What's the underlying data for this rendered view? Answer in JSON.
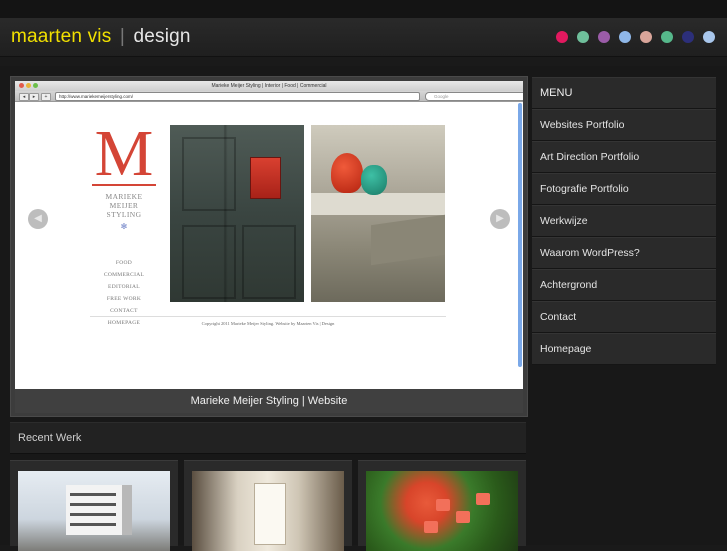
{
  "header": {
    "logo_name": "maarten vis",
    "logo_sep": "|",
    "logo_design": "design",
    "color_dots": [
      "#e2195f",
      "#6fbf9b",
      "#9b5ca8",
      "#8fb7e8",
      "#d9a59a",
      "#56b88b",
      "#2c2f7a",
      "#a9c7ec"
    ]
  },
  "showcase": {
    "browser_title": "Marieke Meijer Styling | Interior | Food | Commercial",
    "browser_url": "http://www.mariekemeijerstyling.com/",
    "browser_search_placeholder": "Google",
    "logo_letter": "M",
    "brand_line1": "MARIEKE",
    "brand_line2": "MEIJER",
    "brand_line3": "STYLING",
    "brand_star": "✻",
    "site_nav": [
      "FOOD",
      "COMMERCIAL",
      "EDITORIAL",
      "FREE WORK",
      "CONTACT",
      "HOMEPAGE"
    ],
    "copyright": "Copyright 2011 Marieke Meijer Styling. Website by Maarten Vis | Design",
    "prev_arrow": "◀",
    "next_arrow": "▶",
    "caption": "Marieke Meijer Styling | Website"
  },
  "recent": {
    "heading": "Recent Werk"
  },
  "sidebar": {
    "menu_heading": "MENU",
    "items": [
      {
        "label": "Websites Portfolio"
      },
      {
        "label": "Art Direction Portfolio"
      },
      {
        "label": "Fotografie Portfolio"
      },
      {
        "label": "Werkwijze"
      },
      {
        "label": "Waarom WordPress?"
      },
      {
        "label": "Achtergrond"
      },
      {
        "label": "Contact"
      },
      {
        "label": "Homepage"
      }
    ]
  }
}
